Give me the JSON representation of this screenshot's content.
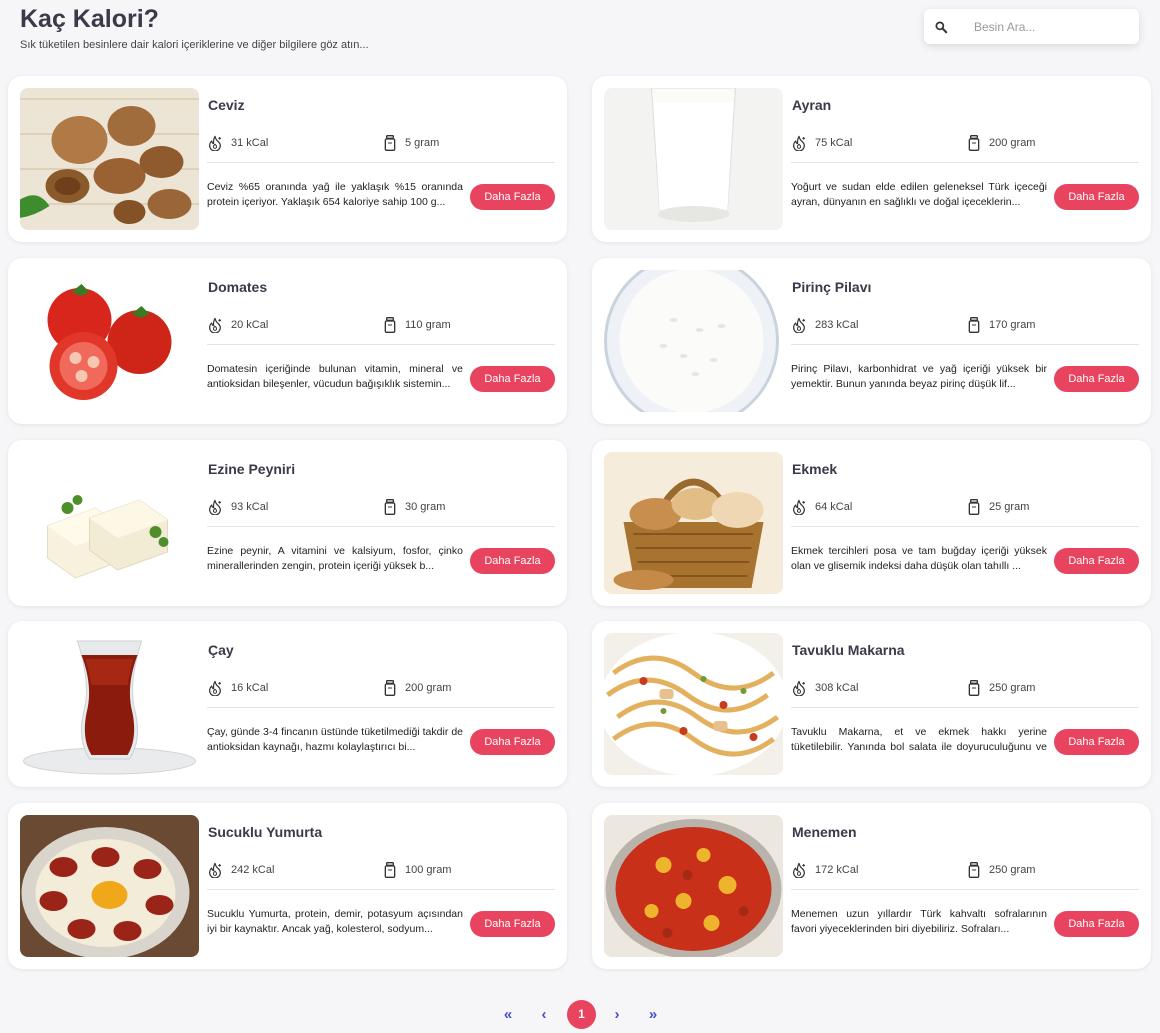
{
  "header": {
    "title": "Kaç Kalori?",
    "subtitle": "Sık tüketilen besinlere dair kalori içeriklerine ve diğer bilgilere göz atın..."
  },
  "search": {
    "placeholder": "Besin Ara..."
  },
  "more_label": "Daha Fazla",
  "foods": [
    {
      "name": "Ceviz",
      "kcal": "31 kCal",
      "gram": "5 gram",
      "desc": "Ceviz %65 oranında yağ ile yaklaşık %15 oranında protein içeriyor. Yaklaşık 654 kaloriye sahip 100 g...",
      "image": "walnut"
    },
    {
      "name": "Ayran",
      "kcal": "75 kCal",
      "gram": "200 gram",
      "desc": "Yoğurt ve sudan elde edilen geleneksel Türk içeceği ayran, dünyanın en sağlıklı ve doğal içeceklerin...",
      "image": "ayran"
    },
    {
      "name": "Domates",
      "kcal": "20 kCal",
      "gram": "110 gram",
      "desc": "Domatesin içeriğinde bulunan vitamin, mineral ve antioksidan bileşenler, vücudun bağışıklık sistemin...",
      "image": "tomato"
    },
    {
      "name": "Pirinç Pilavı",
      "kcal": "283 kCal",
      "gram": "170 gram",
      "desc": "Pirinç Pilavı, karbonhidrat ve yağ içeriği yüksek bir yemektir. Bunun yanında beyaz pirinç düşük lif...",
      "image": "rice"
    },
    {
      "name": "Ezine Peyniri",
      "kcal": "93 kCal",
      "gram": "30 gram",
      "desc": "Ezine peynir, A vitamini ve kalsiyum, fosfor, çinko minerallerinden zengin, protein içeriği yüksek b...",
      "image": "cheese"
    },
    {
      "name": "Ekmek",
      "kcal": "64 kCal",
      "gram": "25 gram",
      "desc": "Ekmek tercihleri posa ve tam buğday içeriği yüksek olan ve glisemik indeksi daha düşük olan tahıllı ...",
      "image": "bread"
    },
    {
      "name": "Çay",
      "kcal": "16 kCal",
      "gram": "200 gram",
      "desc": "Çay, günde 3-4 fincanın üstünde tüketilmediği takdir de antioksidan kaynağı, hazmı kolaylaştırıcı bi...",
      "image": "tea"
    },
    {
      "name": "Tavuklu Makarna",
      "kcal": "308 kCal",
      "gram": "250 gram",
      "desc": "Tavuklu Makarna, et ve ekmek hakkı yerine tüketilebilir. Yanında bol salata ile doyuruculuğunu ve be...",
      "image": "pasta"
    },
    {
      "name": "Sucuklu Yumurta",
      "kcal": "242 kCal",
      "gram": "100 gram",
      "desc": "Sucuklu Yumurta, protein, demir, potasyum açısından iyi bir kaynaktır. Ancak yağ, kolesterol, sodyum...",
      "image": "sucuk"
    },
    {
      "name": "Menemen",
      "kcal": "172 kCal",
      "gram": "250 gram",
      "desc": "Menemen uzun yıllardır Türk kahvaltı sofralarının favori yiyeceklerinden biri diyebiliriz. Sofraları...",
      "image": "menemen"
    }
  ],
  "pagination": {
    "first": "«",
    "prev": "‹",
    "current": "1",
    "next": "›",
    "last": "»"
  },
  "colors": {
    "accent": "#e8435f",
    "pager": "#4a4ad0",
    "title": "#3a3a48"
  }
}
